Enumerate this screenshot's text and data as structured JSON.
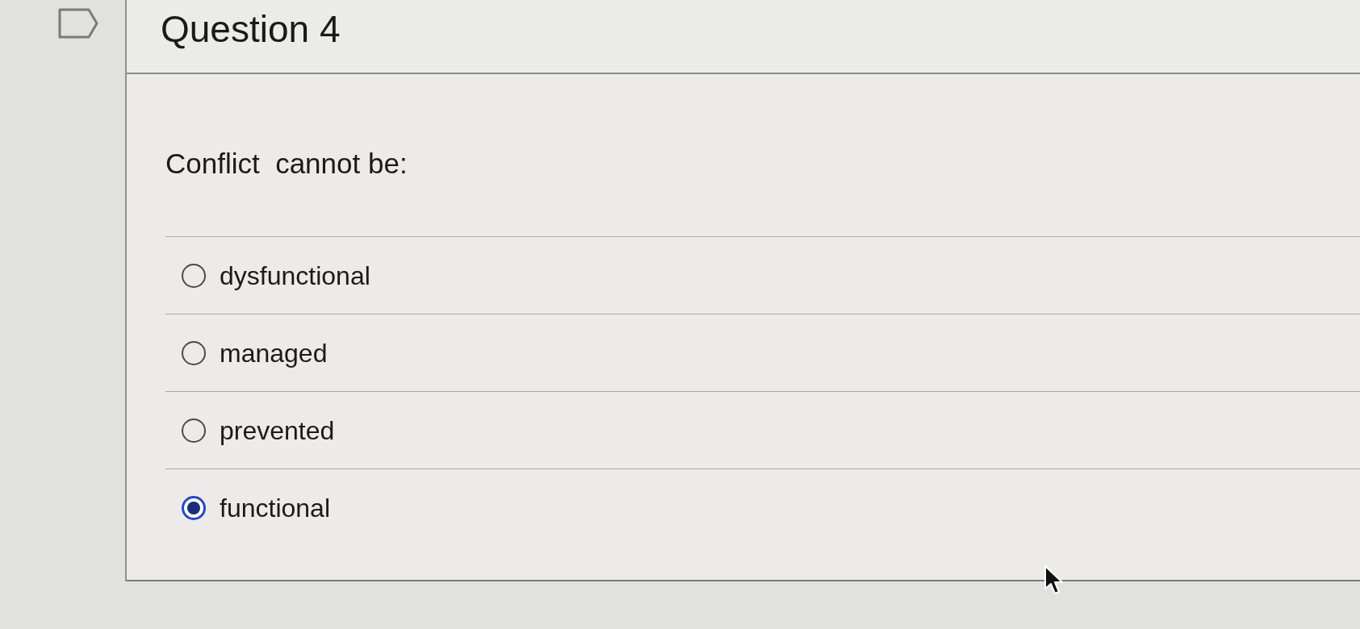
{
  "question": {
    "flagged": false,
    "title": "Question 4",
    "prompt": "Conflict  cannot be:",
    "options": [
      {
        "label": "dysfunctional",
        "selected": false
      },
      {
        "label": "managed",
        "selected": false
      },
      {
        "label": "prevented",
        "selected": false
      },
      {
        "label": "functional",
        "selected": true
      }
    ]
  }
}
